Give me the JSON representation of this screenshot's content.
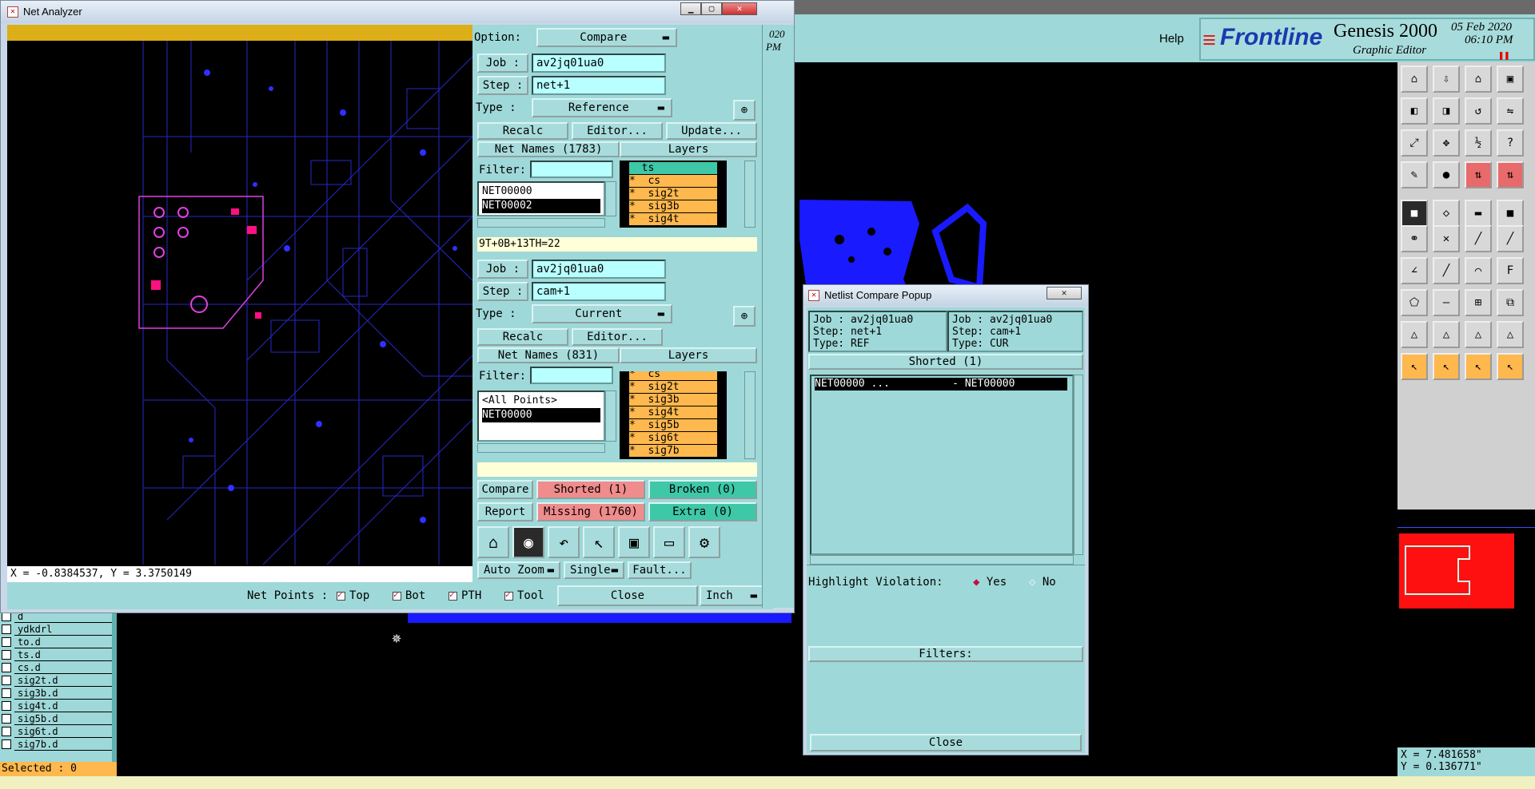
{
  "colors": {
    "panel": "#9fd8d8",
    "input": "#b8ffff",
    "layer_orange": "#ffb84d",
    "shorted": "#f08c8c",
    "ok_green": "#3ec8a8",
    "board_blue": "#1a1aff",
    "accent_red": "#e00000"
  },
  "net_analyzer": {
    "title": "Net Analyzer",
    "coords": "X = -0.8384537, Y = 3.3750149",
    "option_label": "Option:",
    "option_value": "Compare",
    "ref": {
      "job_label": "Job  :",
      "job_value": "av2jq01ua0",
      "step_label": "Step :",
      "step_value": "net+1",
      "type_label": "Type :",
      "type_value": "Reference",
      "btn_recalc": "Recalc",
      "btn_editor": "Editor...",
      "btn_update": "Update...",
      "net_names_header": "Net Names (1783)",
      "layers_header": "Layers",
      "filter_label": "Filter:",
      "nets": [
        "NET00000",
        "NET00002"
      ],
      "layers": [
        "  ts",
        "*  cs",
        "*  sig2t",
        "*  sig3b",
        "*  sig4t"
      ],
      "formula": "9T+0B+13TH=22"
    },
    "cur": {
      "job_label": "Job  :",
      "job_value": "av2jq01ua0",
      "step_label": "Step :",
      "step_value": "cam+1",
      "type_label": "Type :",
      "type_value": "Current",
      "btn_recalc": "Recalc",
      "btn_editor": "Editor...",
      "net_names_header": "Net Names (831)",
      "layers_header": "Layers",
      "filter_label": "Filter:",
      "nets": [
        "<All Points>",
        "NET00000"
      ],
      "layers": [
        "*  cs",
        "*  sig2t",
        "*  sig3b",
        "*  sig4t",
        "*  sig5b",
        "*  sig6t",
        "*  sig7b"
      ]
    },
    "btn_compare": "Compare",
    "btn_report": "Report",
    "shorted": "Shorted (1)",
    "broken": "Broken (0)",
    "missing": "Missing (1760)",
    "extra": "Extra (0)",
    "auto_zoom": "Auto Zoom",
    "single": "Single",
    "fault": "Fault...",
    "net_points_label": "Net Points :",
    "np_top": "Top",
    "np_bot": "Bot",
    "np_pth": "PTH",
    "np_tool": "Tool",
    "close": "Close",
    "unit": "Inch"
  },
  "popup": {
    "title": "Netlist Compare Popup",
    "left": {
      "job": "Job : av2jq01ua0",
      "step": "Step: net+1",
      "type": "Type: REF"
    },
    "right": {
      "job": "Job : av2jq01ua0",
      "step": "Step: cam+1",
      "type": "Type: CUR"
    },
    "shorted_header": "Shorted (1)",
    "rows": [
      "NET00000 ...          - NET00000"
    ],
    "highlight_label": "Highlight Violation:",
    "yes": "Yes",
    "no": "No",
    "filters_header": "Filters:",
    "close": "Close"
  },
  "genesis": {
    "help": "Help",
    "brand": "Frontline",
    "product": "Genesis 2000",
    "subtitle": "Graphic Editor",
    "date": "05 Feb 2020",
    "time": "06:10 PM",
    "coord_x": "X = 7.481658\"",
    "coord_y": "Y = 0.136771\"",
    "layer_list": [
      "d",
      "ydkdrl",
      "to.d",
      "ts.d",
      "cs.d",
      "sig2t.d",
      "sig3b.d",
      "sig4t.d",
      "sig5b.d",
      "sig6t.d",
      "sig7b.d"
    ],
    "selected": "Selected : 0",
    "side_snippets": {
      "top": "020",
      "pm": "PM"
    }
  }
}
